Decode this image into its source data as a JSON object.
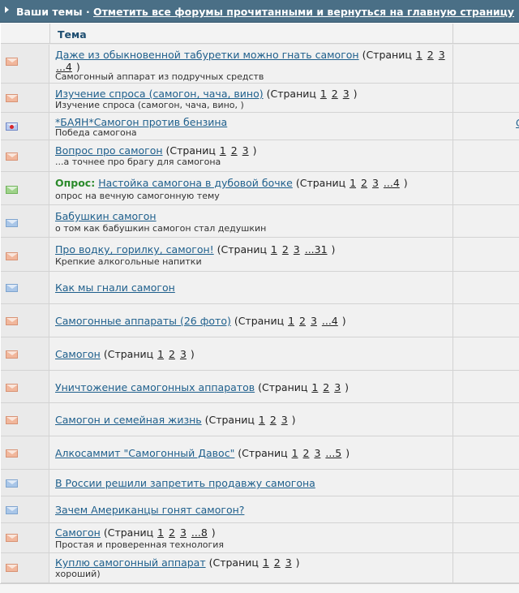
{
  "title": {
    "prefix": "Ваши темы",
    "separator": " · ",
    "link": "Отметить все форумы прочитанными и вернуться на главную страницу"
  },
  "header": {
    "topic_label": "Тема"
  },
  "pages_label": "Страниц",
  "rows": [
    {
      "icon": "orange",
      "title": "Даже из обыкновенной табуретки можно гнать самогон",
      "pages": [
        "1",
        "2",
        "3",
        "...4"
      ],
      "desc": "Самогонный аппарат из подручных средств",
      "wrapped": true
    },
    {
      "icon": "orange",
      "title": "Изучение спроса (самогон, чача, вино)",
      "pages": [
        "1",
        "2",
        "3"
      ],
      "desc": "Изучение спроса (самогон, чача, вино, )"
    },
    {
      "icon": "hot",
      "title": "*БАЯН*Самогон против бензина",
      "pages": [],
      "desc": "Победа самогона",
      "side": "С"
    },
    {
      "icon": "orange",
      "title": "Вопрос про самогон",
      "pages": [
        "1",
        "2",
        "3"
      ],
      "desc": "...а точнее про брагу для самогона"
    },
    {
      "icon": "green",
      "poll": "Опрос:",
      "title": "Настойка самогона в дубовой бочке",
      "pages": [
        "1",
        "2",
        "3",
        "...4"
      ],
      "desc": "опрос на вечную самогонную тему"
    },
    {
      "icon": "blue",
      "title": "Бабушкин самогон",
      "pages": [],
      "desc": "о том как бабушкин самогон стал дедушкин"
    },
    {
      "icon": "orange",
      "title": "Про водку, горилку, самогон!",
      "pages": [
        "1",
        "2",
        "3",
        "...31"
      ],
      "desc": "Крепкие алкогольные напитки"
    },
    {
      "icon": "blue",
      "title": "Как мы гнали самогон",
      "pages": [],
      "desc": ""
    },
    {
      "icon": "orange",
      "title": "Самогонные аппараты (26 фото)",
      "pages": [
        "1",
        "2",
        "3",
        "...4"
      ],
      "desc": ""
    },
    {
      "icon": "orange",
      "title": "Самогон",
      "pages": [
        "1",
        "2",
        "3"
      ],
      "desc": ""
    },
    {
      "icon": "orange",
      "title": "Уничтожение самогонных аппаратов",
      "pages": [
        "1",
        "2",
        "3"
      ],
      "desc": ""
    },
    {
      "icon": "orange",
      "title": "Самогон и семейная жизнь",
      "pages": [
        "1",
        "2",
        "3"
      ],
      "desc": ""
    },
    {
      "icon": "orange",
      "title": "Алкосаммит \"Самогонный Давос\"",
      "pages": [
        "1",
        "2",
        "3",
        "...5"
      ],
      "desc": ""
    },
    {
      "icon": "blue",
      "title": "В России решили запретить продавжу самогона",
      "pages": [],
      "desc": ""
    },
    {
      "icon": "blue",
      "title": "Зачем Американцы гонят самогон?",
      "pages": [],
      "desc": ""
    },
    {
      "icon": "orange",
      "title": "Самогон",
      "pages": [
        "1",
        "2",
        "3",
        "...8"
      ],
      "desc": "Простая и проверенная технология"
    },
    {
      "icon": "orange",
      "title": "Куплю самогонный аппарат",
      "pages": [
        "1",
        "2",
        "3"
      ],
      "desc": "хороший)"
    }
  ],
  "colors": {
    "titlebar": "#4a6f86",
    "link": "#1e5f8c",
    "poll": "#2b8a2b"
  }
}
